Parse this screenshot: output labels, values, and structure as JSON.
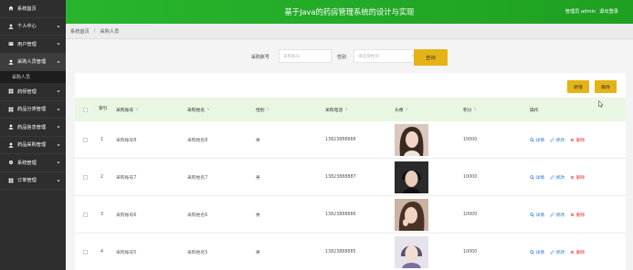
{
  "header": {
    "title": "基于Java的药房管理系统的设计与实现",
    "user_label": "管理员 admin",
    "logout": "退出登录"
  },
  "sidebar": {
    "items": [
      {
        "label": "系统首页",
        "icon": "home-icon",
        "chevron": false
      },
      {
        "label": "个人中心",
        "icon": "user-icon",
        "chevron": true
      },
      {
        "label": "用户管理",
        "icon": "users-icon",
        "chevron": true
      },
      {
        "label": "采购人员管理",
        "icon": "person-icon",
        "chevron": true,
        "expanded": true
      },
      {
        "label": "药师管理",
        "icon": "grid-icon",
        "chevron": true
      },
      {
        "label": "药品分类管理",
        "icon": "grid-icon",
        "chevron": true
      },
      {
        "label": "药品信息管理",
        "icon": "person-icon",
        "chevron": true
      },
      {
        "label": "药品采购管理",
        "icon": "person-icon",
        "chevron": true
      },
      {
        "label": "系统管理",
        "icon": "gear-icon",
        "chevron": true
      },
      {
        "label": "订单管理",
        "icon": "grid-icon",
        "chevron": true
      }
    ],
    "sub_item": "采购人员"
  },
  "breadcrumb": {
    "home": "系统首页",
    "sep": "/",
    "current": "采购人员"
  },
  "search": {
    "field1_label": "采购账号",
    "field1_placeholder": "采购账号",
    "field2_label": "性别",
    "field2_placeholder": "请选择性别",
    "button": "查询"
  },
  "toolbar": {
    "add": "新增",
    "delete": "删除"
  },
  "table": {
    "columns": {
      "index": "索引",
      "account": "采购账号",
      "name": "采购姓名",
      "gender": "性别",
      "phone": "采购电话",
      "avatar": "头像",
      "points": "积分",
      "ops": "操作"
    },
    "ops": {
      "detail": "详情",
      "edit": "修改",
      "delete": "删除"
    },
    "rows": [
      {
        "index": "1",
        "account": "采购账号8",
        "name": "采购姓名8",
        "gender": "男",
        "phone": "13823888888",
        "points": "10000"
      },
      {
        "index": "2",
        "account": "采购账号7",
        "name": "采购姓名7",
        "gender": "男",
        "phone": "13823888887",
        "points": "10000"
      },
      {
        "index": "3",
        "account": "采购账号6",
        "name": "采购姓名6",
        "gender": "男",
        "phone": "13823888886",
        "points": "10000"
      },
      {
        "index": "4",
        "account": "采购账号5",
        "name": "采购姓名5",
        "gender": "男",
        "phone": "13823888885",
        "points": "10000"
      }
    ]
  },
  "colors": {
    "header_green": "#28b52d",
    "sidebar_bg": "#2e2e2e",
    "accent_yellow": "#e5b316",
    "table_head": "#e9f7e2"
  }
}
